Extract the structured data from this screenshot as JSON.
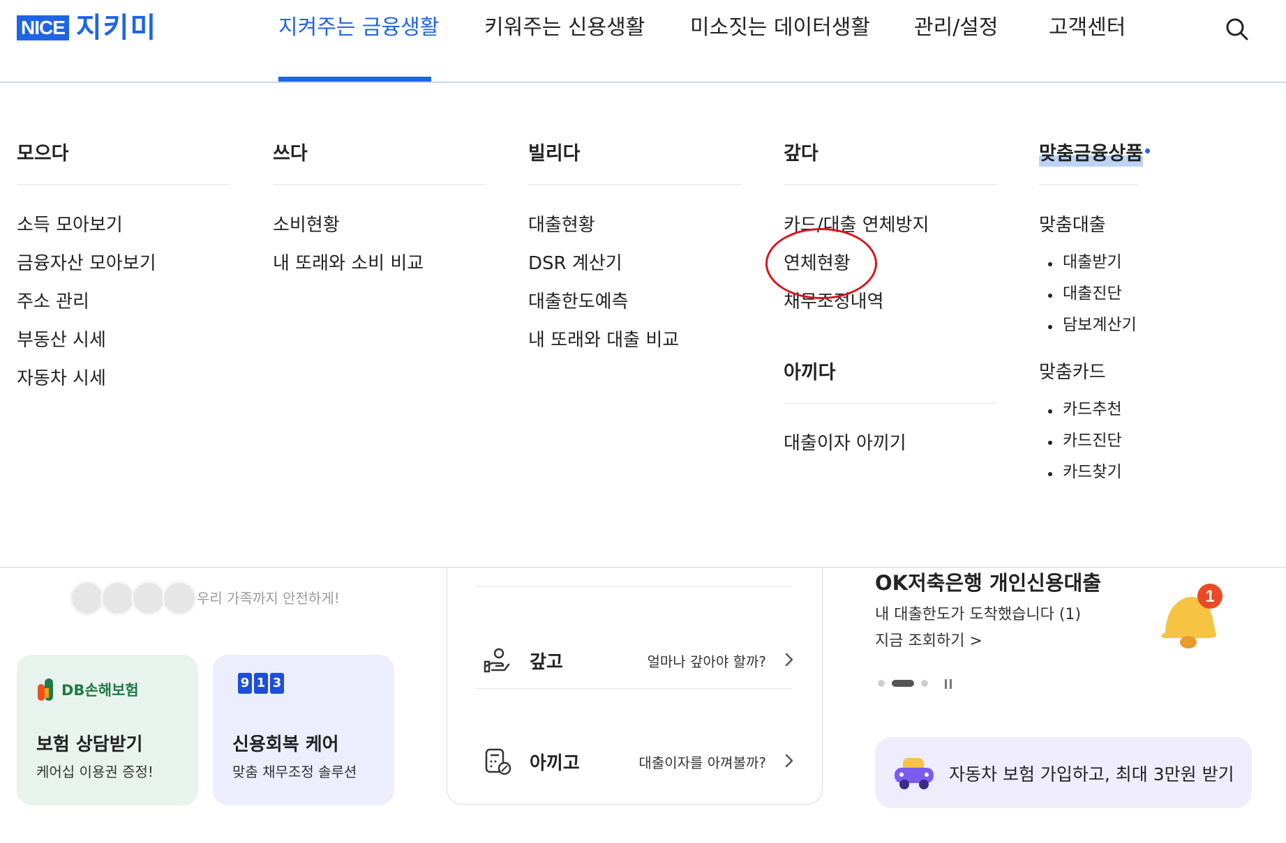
{
  "header": {
    "logo_nice": "NICE",
    "logo_text": "지키미",
    "nav": [
      {
        "label": "지켜주는 금융생활",
        "active": true
      },
      {
        "label": "키워주는 신용생활",
        "active": false
      },
      {
        "label": "미소짓는 데이터생활",
        "active": false
      },
      {
        "label": "관리/설정",
        "active": false
      },
      {
        "label": "고객센터",
        "active": false
      }
    ],
    "search_icon": "search-icon",
    "accent_color": "#1e64e6"
  },
  "mega_menu": {
    "columns": [
      {
        "title": "모으다",
        "items": [
          "소득 모아보기",
          "금융자산 모아보기",
          "주소 관리",
          "부동산 시세",
          "자동차 시세"
        ]
      },
      {
        "title": "쓰다",
        "items": [
          "소비현황",
          "내 또래와 소비 비교"
        ]
      },
      {
        "title": "빌리다",
        "items": [
          "대출현황",
          "DSR 계산기",
          "대출한도예측",
          "내 또래와 대출 비교"
        ]
      },
      {
        "title": "갚다",
        "items": [
          "카드/대출 연체방지",
          "연체현황",
          "채무조정내역"
        ],
        "title2": "아끼다",
        "items2": [
          "대출이자 아끼기"
        ]
      },
      {
        "title": "맞춤금융상품",
        "group1": {
          "title": "맞춤대출",
          "items": [
            "대출받기",
            "대출진단",
            "담보계산기"
          ]
        },
        "group2": {
          "title": "맞춤카드",
          "items": [
            "카드추천",
            "카드진단",
            "카드찾기"
          ]
        }
      }
    ],
    "annotation_color": "#d9141c"
  },
  "content": {
    "family_text": "우리 가족까지 안전하게!",
    "card1": {
      "logo": "DB손해보험",
      "title": "보험 상담받기",
      "sub": "케어십 이용권 증정!"
    },
    "card2": {
      "digits": [
        "9",
        "1",
        "3"
      ],
      "title": "신용회복 케어",
      "sub": "맞춤 채무조정 솔루션"
    },
    "mid": [
      {
        "icon": "hand-coin-icon",
        "title": "갚고",
        "desc": "얼마나 갚아야 할까?"
      },
      {
        "icon": "calculator-percent-icon",
        "title": "아끼고",
        "desc": "대출이자를 아껴볼까?"
      }
    ],
    "promo": {
      "title": "OK저축은행 개인신용대출",
      "sub": "내 대출한도가 도착했습니다 (1)",
      "link": "지금 조회하기 >",
      "badge": "1"
    },
    "car_banner": {
      "text": "자동차 보험 가입하고, 최대 3만원 받기"
    }
  }
}
